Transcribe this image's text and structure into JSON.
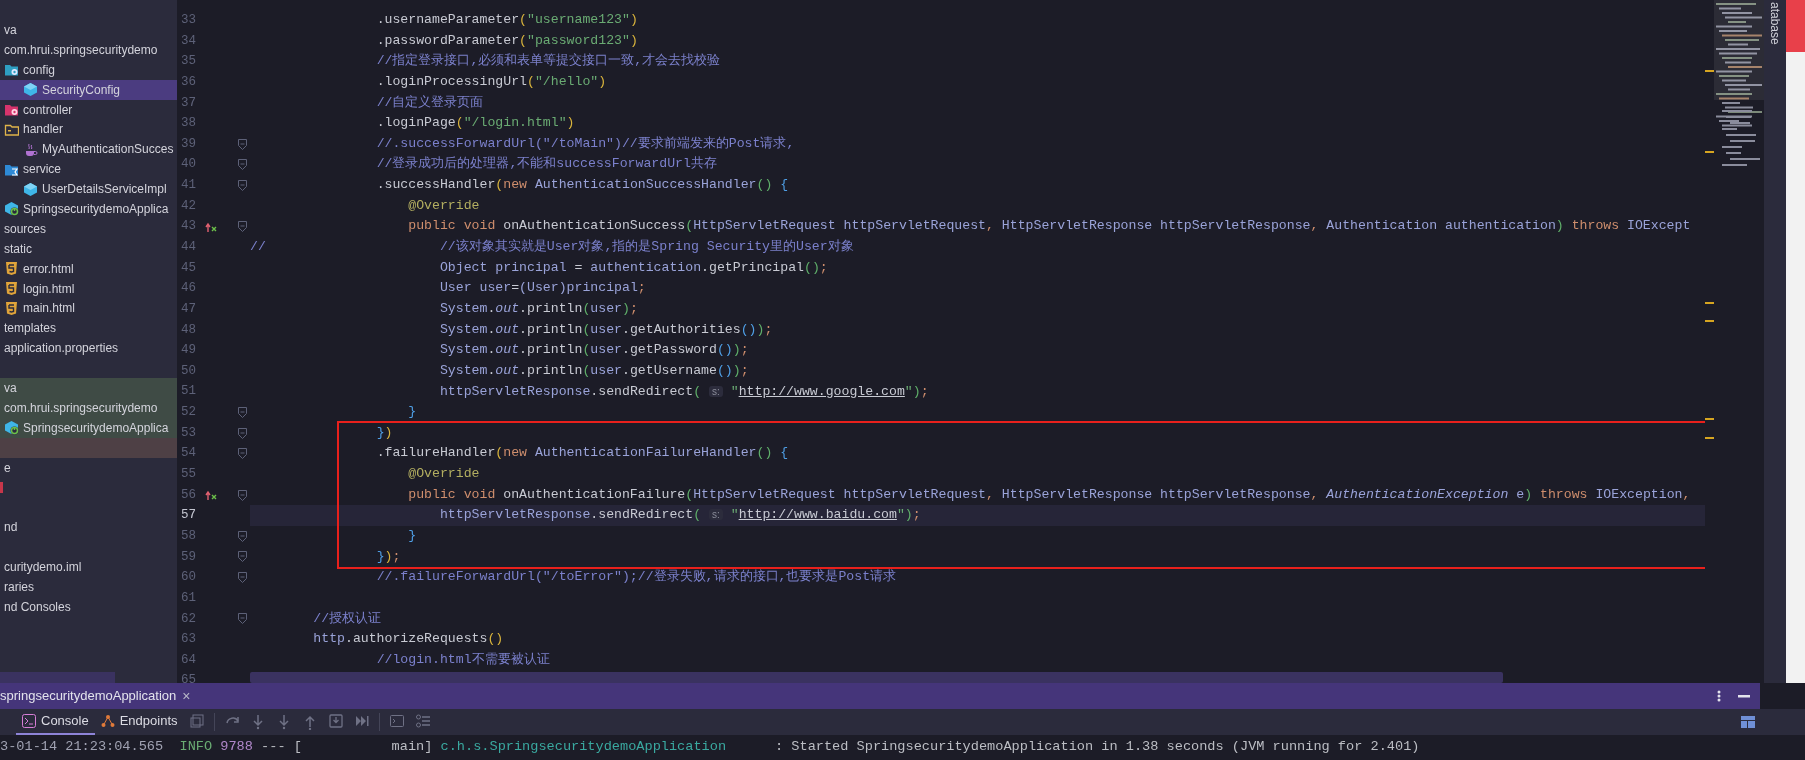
{
  "sidebar": {
    "groups": [
      {
        "items": [
          {
            "label": "va",
            "selected": false,
            "children": [
              {
                "label": "com.hrui.springsecuritydemo",
                "selected": false,
                "children": [
                  {
                    "label": "config",
                    "kind": "configfolder",
                    "selected": false,
                    "children": [
                      {
                        "label": "SecurityConfig",
                        "kind": "class",
                        "selected": true
                      }
                    ]
                  },
                  {
                    "label": "controller",
                    "kind": "controllerfolder",
                    "selected": false
                  },
                  {
                    "label": "handler",
                    "kind": "folder",
                    "selected": false,
                    "children": [
                      {
                        "label": "MyAuthenticationSucces",
                        "kind": "java",
                        "selected": false
                      }
                    ]
                  },
                  {
                    "label": "service",
                    "kind": "servicefolder",
                    "selected": false,
                    "children": [
                      {
                        "label": "UserDetailsServiceImpl",
                        "kind": "class",
                        "selected": false
                      }
                    ]
                  },
                  {
                    "label": "SpringsecuritydemoApplica",
                    "kind": "app",
                    "selected": false
                  }
                ]
              }
            ]
          },
          {
            "label": "sources",
            "selected": false,
            "children": [
              {
                "label": "static",
                "selected": false,
                "children": [
                  {
                    "label": "error.html",
                    "kind": "html",
                    "selected": false
                  },
                  {
                    "label": "login.html",
                    "kind": "html",
                    "selected": false
                  },
                  {
                    "label": "main.html",
                    "kind": "html",
                    "selected": false
                  }
                ]
              },
              {
                "label": "templates",
                "selected": false
              },
              {
                "label": "application.properties",
                "selected": false
              }
            ]
          }
        ]
      },
      {
        "items": [
          {
            "label": "va",
            "selected": false,
            "color": "#3f4b45",
            "children": [
              {
                "label": "com.hrui.springsecuritydemo",
                "selected": false,
                "color": "#3f4b45",
                "children": [
                  {
                    "label": "SpringsecuritydemoApplica",
                    "kind": "app",
                    "selected": false,
                    "color": "#3f4b45"
                  }
                ]
              }
            ]
          },
          {
            "selected": false,
            "color": "#4e4045"
          },
          {
            "label": "e",
            "selected": false
          },
          {
            "kind": "errormark",
            "selected": false
          }
        ]
      },
      {
        "items": [
          {
            "label": "nd",
            "selected": false
          }
        ]
      },
      {
        "items": [
          {
            "label": "curitydemo.iml",
            "selected": false
          },
          {
            "label": "raries",
            "selected": false
          },
          {
            "label": "nd Consoles",
            "selected": false
          }
        ]
      }
    ]
  },
  "editor": {
    "lines": [
      {
        "number": "33",
        "fold": false,
        "implements": false,
        "current": false,
        "boxed": false,
        "tokens": [
          {
            "kind": "plain",
            "text": "                .usernameParameter"
          },
          {
            "kind": "gold",
            "text": "("
          },
          {
            "kind": "str",
            "text": "\"username123\""
          },
          {
            "kind": "gold",
            "text": ")"
          }
        ]
      },
      {
        "number": "34",
        "fold": false,
        "implements": false,
        "current": false,
        "boxed": false,
        "tokens": [
          {
            "kind": "plain",
            "text": "                .passwordParameter"
          },
          {
            "kind": "gold",
            "text": "("
          },
          {
            "kind": "str",
            "text": "\"password123\""
          },
          {
            "kind": "gold",
            "text": ")"
          }
        ]
      },
      {
        "number": "35",
        "fold": false,
        "implements": false,
        "current": false,
        "boxed": false,
        "tokens": [
          {
            "kind": "cmt",
            "text": "                //指定登录接口,必须和表单等提交接口一致,才会去找校验"
          }
        ]
      },
      {
        "number": "36",
        "fold": false,
        "implements": false,
        "current": false,
        "boxed": false,
        "tokens": [
          {
            "kind": "plain",
            "text": "                .loginProcessingUrl"
          },
          {
            "kind": "gold",
            "text": "("
          },
          {
            "kind": "str",
            "text": "\"/hello\""
          },
          {
            "kind": "gold",
            "text": ")"
          }
        ]
      },
      {
        "number": "37",
        "fold": false,
        "implements": false,
        "current": false,
        "boxed": false,
        "tokens": [
          {
            "kind": "cmt",
            "text": "                //自定义登录页面"
          }
        ]
      },
      {
        "number": "38",
        "fold": false,
        "implements": false,
        "current": false,
        "boxed": false,
        "tokens": [
          {
            "kind": "plain",
            "text": "                .loginPage"
          },
          {
            "kind": "gold",
            "text": "("
          },
          {
            "kind": "str",
            "text": "\"/login.html\""
          },
          {
            "kind": "gold",
            "text": ")"
          }
        ]
      },
      {
        "number": "39",
        "fold": true,
        "implements": false,
        "current": false,
        "boxed": false,
        "tokens": [
          {
            "kind": "cmt",
            "text": "                //.successForwardUrl(\"/toMain\")//要求前端发来的Post请求,"
          }
        ]
      },
      {
        "number": "40",
        "fold": true,
        "implements": false,
        "current": false,
        "boxed": false,
        "tokens": [
          {
            "kind": "cmt",
            "text": "                //登录成功后的处理器,不能和successForwardUrl共存"
          }
        ]
      },
      {
        "number": "41",
        "fold": true,
        "implements": false,
        "current": false,
        "boxed": false,
        "tokens": [
          {
            "kind": "plain",
            "text": "                .successHandler"
          },
          {
            "kind": "gold",
            "text": "("
          },
          {
            "kind": "kw",
            "text": "new "
          },
          {
            "kind": "ident",
            "text": "AuthenticationSuccessHandler"
          },
          {
            "kind": "green",
            "text": "() "
          },
          {
            "kind": "blue",
            "text": "{"
          }
        ]
      },
      {
        "number": "42",
        "fold": false,
        "implements": false,
        "current": false,
        "boxed": false,
        "tokens": [
          {
            "kind": "ann",
            "text": "                    @Override"
          }
        ]
      },
      {
        "number": "43",
        "fold": true,
        "implements": true,
        "current": false,
        "boxed": false,
        "tokens": [
          {
            "kind": "kw",
            "text": "                    public void "
          },
          {
            "kind": "plain",
            "text": "onAuthenticationSuccess"
          },
          {
            "kind": "green",
            "text": "("
          },
          {
            "kind": "ident",
            "text": "HttpServletRequest httpServletRequest"
          },
          {
            "kind": "kw",
            "text": ", "
          },
          {
            "kind": "ident",
            "text": "HttpServletResponse httpServletResponse"
          },
          {
            "kind": "kw",
            "text": ", "
          },
          {
            "kind": "ident",
            "text": "Authentication authentication"
          },
          {
            "kind": "green",
            "text": ") "
          },
          {
            "kind": "kw",
            "text": "throws "
          },
          {
            "kind": "ident",
            "text": "IOExcept"
          }
        ]
      },
      {
        "number": "44",
        "fold": false,
        "implements": false,
        "current": false,
        "boxed": false,
        "tokens": [
          {
            "kind": "cmt",
            "text": "//                      //该对象其实就是User对象,指的是Spring Security里的User对象"
          }
        ]
      },
      {
        "number": "45",
        "fold": false,
        "implements": false,
        "current": false,
        "boxed": false,
        "tokens": [
          {
            "kind": "ident",
            "text": "                        Object principal "
          },
          {
            "kind": "plain",
            "text": "= "
          },
          {
            "kind": "ident",
            "text": "authentication"
          },
          {
            "kind": "plain",
            "text": ".getPrincipal"
          },
          {
            "kind": "green",
            "text": "()"
          },
          {
            "kind": "kw",
            "text": ";"
          }
        ]
      },
      {
        "number": "46",
        "fold": false,
        "implements": false,
        "current": false,
        "boxed": false,
        "tokens": [
          {
            "kind": "ident",
            "text": "                        User user"
          },
          {
            "kind": "plain",
            "text": "="
          },
          {
            "kind": "ident",
            "text": "(User)principal"
          },
          {
            "kind": "kw",
            "text": ";"
          }
        ]
      },
      {
        "number": "47",
        "fold": false,
        "implements": false,
        "current": false,
        "boxed": false,
        "tokens": [
          {
            "kind": "ident",
            "text": "                        System"
          },
          {
            "kind": "plain",
            "text": "."
          },
          {
            "kind": "static",
            "text": "out"
          },
          {
            "kind": "plain",
            "text": ".println"
          },
          {
            "kind": "green",
            "text": "("
          },
          {
            "kind": "ident",
            "text": "user"
          },
          {
            "kind": "green",
            "text": ")"
          },
          {
            "kind": "kw",
            "text": ";"
          }
        ]
      },
      {
        "number": "48",
        "fold": false,
        "implements": false,
        "current": false,
        "boxed": false,
        "tokens": [
          {
            "kind": "ident",
            "text": "                        System"
          },
          {
            "kind": "plain",
            "text": "."
          },
          {
            "kind": "static",
            "text": "out"
          },
          {
            "kind": "plain",
            "text": ".println"
          },
          {
            "kind": "green",
            "text": "("
          },
          {
            "kind": "ident",
            "text": "user"
          },
          {
            "kind": "plain",
            "text": ".getAuthorities"
          },
          {
            "kind": "blue",
            "text": "()"
          },
          {
            "kind": "green",
            "text": ")"
          },
          {
            "kind": "kw",
            "text": ";"
          }
        ]
      },
      {
        "number": "49",
        "fold": false,
        "implements": false,
        "current": false,
        "boxed": false,
        "tokens": [
          {
            "kind": "ident",
            "text": "                        System"
          },
          {
            "kind": "plain",
            "text": "."
          },
          {
            "kind": "static",
            "text": "out"
          },
          {
            "kind": "plain",
            "text": ".println"
          },
          {
            "kind": "green",
            "text": "("
          },
          {
            "kind": "ident",
            "text": "user"
          },
          {
            "kind": "plain",
            "text": ".getPassword"
          },
          {
            "kind": "blue",
            "text": "()"
          },
          {
            "kind": "green",
            "text": ")"
          },
          {
            "kind": "kw",
            "text": ";"
          }
        ]
      },
      {
        "number": "50",
        "fold": false,
        "implements": false,
        "current": false,
        "boxed": false,
        "tokens": [
          {
            "kind": "ident",
            "text": "                        System"
          },
          {
            "kind": "plain",
            "text": "."
          },
          {
            "kind": "static",
            "text": "out"
          },
          {
            "kind": "plain",
            "text": ".println"
          },
          {
            "kind": "green",
            "text": "("
          },
          {
            "kind": "ident",
            "text": "user"
          },
          {
            "kind": "plain",
            "text": ".getUsername"
          },
          {
            "kind": "blue",
            "text": "()"
          },
          {
            "kind": "green",
            "text": ")"
          },
          {
            "kind": "kw",
            "text": ";"
          }
        ]
      },
      {
        "number": "51",
        "fold": false,
        "implements": false,
        "current": false,
        "boxed": false,
        "tokens": [
          {
            "kind": "ident",
            "text": "                        httpServletResponse"
          },
          {
            "kind": "plain",
            "text": ".sendRedirect"
          },
          {
            "kind": "green",
            "text": "( "
          },
          {
            "kind": "hint",
            "text": "s:"
          },
          {
            "kind": "str",
            "text": " \""
          },
          {
            "kind": "link",
            "text": "http://www.google.com"
          },
          {
            "kind": "str",
            "text": "\""
          },
          {
            "kind": "green",
            "text": ")"
          },
          {
            "kind": "kw",
            "text": ";"
          }
        ]
      },
      {
        "number": "52",
        "fold": true,
        "implements": false,
        "current": false,
        "boxed": false,
        "tokens": [
          {
            "kind": "blue",
            "text": "                    }"
          }
        ]
      },
      {
        "number": "53",
        "fold": true,
        "implements": false,
        "current": false,
        "boxed": true,
        "tokens": [
          {
            "kind": "blue",
            "text": "                }"
          },
          {
            "kind": "gold",
            "text": ")"
          }
        ]
      },
      {
        "number": "54",
        "fold": true,
        "implements": false,
        "current": false,
        "boxed": true,
        "tokens": [
          {
            "kind": "plain",
            "text": "                .failureHandler"
          },
          {
            "kind": "gold",
            "text": "("
          },
          {
            "kind": "kw",
            "text": "new "
          },
          {
            "kind": "ident",
            "text": "AuthenticationFailureHandler"
          },
          {
            "kind": "green",
            "text": "() "
          },
          {
            "kind": "blue",
            "text": "{"
          }
        ]
      },
      {
        "number": "55",
        "fold": false,
        "implements": false,
        "current": false,
        "boxed": true,
        "tokens": [
          {
            "kind": "ann",
            "text": "                    @Override"
          }
        ]
      },
      {
        "number": "56",
        "fold": true,
        "implements": true,
        "current": false,
        "boxed": true,
        "tokens": [
          {
            "kind": "kw",
            "text": "                    public void "
          },
          {
            "kind": "plain",
            "text": "onAuthenticationFailure"
          },
          {
            "kind": "green",
            "text": "("
          },
          {
            "kind": "ident",
            "text": "HttpServletRequest httpServletRequest"
          },
          {
            "kind": "kw",
            "text": ", "
          },
          {
            "kind": "ident",
            "text": "HttpServletResponse httpServletResponse"
          },
          {
            "kind": "kw",
            "text": ", "
          },
          {
            "kind": "italic",
            "text": "AuthenticationException "
          },
          {
            "kind": "ident",
            "text": "e"
          },
          {
            "kind": "green",
            "text": ") "
          },
          {
            "kind": "kw",
            "text": "throws "
          },
          {
            "kind": "ident",
            "text": "IOException"
          },
          {
            "kind": "kw",
            "text": ","
          }
        ]
      },
      {
        "number": "57",
        "fold": false,
        "implements": false,
        "current": true,
        "boxed": true,
        "tokens": [
          {
            "kind": "ident",
            "text": "                        httpServletResponse"
          },
          {
            "kind": "plain",
            "text": ".sendRedirect"
          },
          {
            "kind": "green",
            "text": "( "
          },
          {
            "kind": "hint",
            "text": "s:"
          },
          {
            "kind": "str",
            "text": " \""
          },
          {
            "kind": "link",
            "text": "http://www.baidu.com"
          },
          {
            "kind": "str",
            "text": "\""
          },
          {
            "kind": "green",
            "text": ")"
          },
          {
            "kind": "kw",
            "text": ";"
          }
        ]
      },
      {
        "number": "58",
        "fold": true,
        "implements": false,
        "current": false,
        "boxed": true,
        "tokens": [
          {
            "kind": "blue",
            "text": "                    }"
          }
        ]
      },
      {
        "number": "59",
        "fold": true,
        "implements": false,
        "current": false,
        "boxed": true,
        "tokens": [
          {
            "kind": "blue",
            "text": "                }"
          },
          {
            "kind": "gold",
            "text": ")"
          },
          {
            "kind": "kw",
            "text": ";"
          }
        ]
      },
      {
        "number": "60",
        "fold": true,
        "implements": false,
        "current": false,
        "boxed": false,
        "tokens": [
          {
            "kind": "cmt",
            "text": "                //.failureForwardUrl(\"/toError\");//登录失败,请求的接口,也要求是Post请求"
          }
        ]
      },
      {
        "number": "61",
        "fold": false,
        "implements": false,
        "current": false,
        "boxed": false
      },
      {
        "number": "62",
        "fold": true,
        "implements": false,
        "current": false,
        "boxed": false,
        "tokens": [
          {
            "kind": "cmt",
            "text": "        //授权认证"
          }
        ]
      },
      {
        "number": "63",
        "fold": false,
        "implements": false,
        "current": false,
        "boxed": false,
        "tokens": [
          {
            "kind": "ident",
            "text": "        http"
          },
          {
            "kind": "plain",
            "text": ".authorizeRequests"
          },
          {
            "kind": "gold",
            "text": "()"
          }
        ]
      },
      {
        "number": "64",
        "fold": false,
        "implements": false,
        "current": false,
        "boxed": false,
        "tokens": [
          {
            "kind": "cmt",
            "text": "                //login.html不需要被认证"
          }
        ]
      },
      {
        "number": "65",
        "fold": false,
        "implements": false,
        "current": false,
        "boxed": false
      }
    ]
  },
  "right_toolbar": {
    "label": "atabase"
  },
  "run_panel": {
    "tab": "springsecuritydemoApplication",
    "close": "×",
    "tabs": [
      {
        "label": "Console",
        "selected": true
      },
      {
        "label": "Endpoints",
        "selected": false
      }
    ],
    "console": [
      {
        "kind": "time",
        "text": "3-01-14 21:23:04.565  "
      },
      {
        "kind": "level",
        "text": "INFO "
      },
      {
        "kind": "pid",
        "text": "9788 "
      },
      {
        "kind": "plain",
        "text": "--- [           main] "
      },
      {
        "kind": "logger",
        "text": "c.h.s.SpringsecuritydemoApplication      "
      },
      {
        "kind": "plain",
        "text": ": Started SpringsecuritydemoApplication in 1.38 seconds (JVM running for 2.401)"
      }
    ]
  }
}
